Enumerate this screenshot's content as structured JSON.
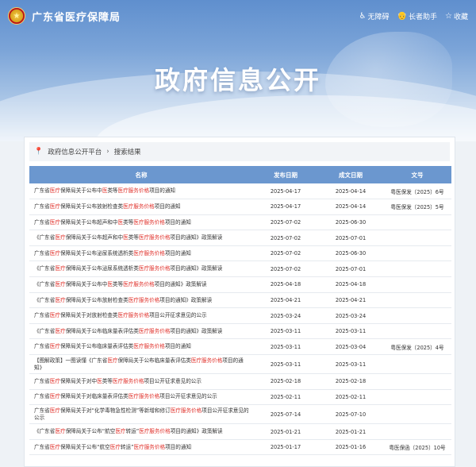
{
  "header": {
    "site_title": "广东省医疗保障局",
    "links": [
      {
        "icon": "accessibility-icon",
        "glyph": "♿",
        "label": "无障碍"
      },
      {
        "icon": "elder-mode-icon",
        "glyph": "👴",
        "label": "长者助手"
      },
      {
        "icon": "star-icon",
        "glyph": "☆",
        "label": "收藏"
      }
    ]
  },
  "banner": {
    "title": "政府信息公开"
  },
  "breadcrumb": {
    "home": "政府信息公开平台",
    "current": "搜索结果"
  },
  "table": {
    "columns": [
      "名称",
      "发布日期",
      "成文日期",
      "文号"
    ],
    "rows": [
      {
        "parts": [
          "广东省",
          "!医疗",
          "保障局关于公布中",
          "!医",
          "类等",
          "!医疗服务价格",
          "项目的通知"
        ],
        "pub": "2025-04-17",
        "doc": "2025-04-14",
        "num": "粤医保发〔2025〕6号"
      },
      {
        "parts": [
          "广东省",
          "!医疗",
          "保障局关于公布放射检查类",
          "!医疗服务价格",
          "项目的通知"
        ],
        "pub": "2025-04-17",
        "doc": "2025-04-14",
        "num": "粤医保发〔2025〕5号"
      },
      {
        "parts": [
          "广东省",
          "!医疗",
          "保障局关于公布超声和中",
          "!医",
          "类等",
          "!医疗服务价格",
          "项目的通知"
        ],
        "pub": "2025-07-02",
        "doc": "2025-06-30",
        "num": ""
      },
      {
        "parts": [
          "《广东省",
          "!医疗",
          "保障局关于公布超声和中",
          "!医",
          "类等",
          "!医疗服务价格",
          "项目的通知》政策解读"
        ],
        "pub": "2025-07-02",
        "doc": "2025-07-01",
        "num": ""
      },
      {
        "parts": [
          "广东省",
          "!医疗",
          "保障局关于公布泌尿系统透析类",
          "!医疗服务价格",
          "项目的通知"
        ],
        "pub": "2025-07-02",
        "doc": "2025-06-30",
        "num": ""
      },
      {
        "parts": [
          "《广东省",
          "!医疗",
          "保障局关于公布泌尿系统透析类",
          "!医疗服务价格",
          "项目的通知》政策解读"
        ],
        "pub": "2025-07-02",
        "doc": "2025-07-01",
        "num": ""
      },
      {
        "parts": [
          "《广东省",
          "!医疗",
          "保障局关于公布中",
          "!医",
          "类等",
          "!医疗服务价格",
          "项目的通知》政策解读"
        ],
        "pub": "2025-04-18",
        "doc": "2025-04-18",
        "num": ""
      },
      {
        "parts": [
          "《广东省",
          "!医疗",
          "保障局关于公布放射检查类",
          "!医疗服务价格",
          "项目的通知》政策解读"
        ],
        "pub": "2025-04-21",
        "doc": "2025-04-21",
        "num": ""
      },
      {
        "parts": [
          "广东省",
          "!医疗",
          "保障局关于对放射检查类",
          "!医疗服务价格",
          "项目公开征求意见的公示"
        ],
        "pub": "2025-03-24",
        "doc": "2025-03-24",
        "num": ""
      },
      {
        "parts": [
          "《广东省",
          "!医疗",
          "保障局关于公布临床量表评估类",
          "!医疗服务价格",
          "项目的通知》政策解读"
        ],
        "pub": "2025-03-11",
        "doc": "2025-03-11",
        "num": ""
      },
      {
        "parts": [
          "广东省",
          "!医疗",
          "保障局关于公布临床量表评估类",
          "!医疗服务价格",
          "项目的通知"
        ],
        "pub": "2025-03-11",
        "doc": "2025-03-04",
        "num": "粤医保发〔2025〕4号"
      },
      {
        "tall": true,
        "parts": [
          "【图解政策】一图读懂《广东省",
          "!医疗",
          "保障局关于公布临床量表评估类",
          "!医疗服务价格",
          "项目的通知》"
        ],
        "pub": "2025-03-11",
        "doc": "2025-03-11",
        "num": ""
      },
      {
        "parts": [
          "广东省",
          "!医疗",
          "保障局关于对中",
          "!医",
          "类等",
          "!医疗服务价格",
          "项目公开征求意见的公示"
        ],
        "pub": "2025-02-18",
        "doc": "2025-02-18",
        "num": ""
      },
      {
        "parts": [
          "广东省",
          "!医疗",
          "保障局关于对临床量表评估类",
          "!医疗服务价格",
          "项目公开征求意见的公示"
        ],
        "pub": "2025-02-11",
        "doc": "2025-02-11",
        "num": ""
      },
      {
        "tall": true,
        "parts": [
          "广东省",
          "!医疗",
          "保障局关于对“化学毒物急性检测”等新增和修订",
          "!医疗服务价格",
          "项目公开征求意见的公示"
        ],
        "pub": "2025-07-14",
        "doc": "2025-07-10",
        "num": ""
      },
      {
        "parts": [
          "《广东省",
          "!医疗",
          "保障局关于公布“航空",
          "!医疗",
          "转运”",
          "!医疗服务价格",
          "项目的通知》政策解读"
        ],
        "pub": "2025-01-21",
        "doc": "2025-01-21",
        "num": ""
      },
      {
        "parts": [
          "广东省",
          "!医疗",
          "保障局关于公布“航空",
          "!医疗",
          "转运”",
          "!医疗服务价格",
          "项目的通知"
        ],
        "pub": "2025-01-17",
        "doc": "2025-01-16",
        "num": "粤医保函〔2025〕10号"
      }
    ]
  }
}
